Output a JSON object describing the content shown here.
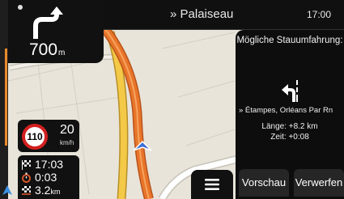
{
  "header": {
    "street": "» Palaiseau",
    "time": "17:00"
  },
  "turn": {
    "distance_value": "700",
    "distance_unit": "m",
    "icon": "turn-left-then-right-icon"
  },
  "speed": {
    "limit": "110",
    "current": "20",
    "unit": "km/h"
  },
  "trip": {
    "arrival_time": "17:03",
    "remaining_time": "0:03",
    "remaining_distance_value": "3.2",
    "remaining_distance_unit": "km"
  },
  "detour": {
    "title": "Mögliche Stauumfahrung:",
    "route": "» Étampes, Orléans Par Rn",
    "length": "Länge: +8.2 km",
    "time": "Zeit: +0:08",
    "preview_label": "Vorschau",
    "discard_label": "Verwerfen"
  },
  "colors": {
    "route_orange": "#e8752a",
    "road_yellow": "#f4c948",
    "speed_ring": "#d21f1f",
    "vehicle": "#3a6fd8"
  }
}
